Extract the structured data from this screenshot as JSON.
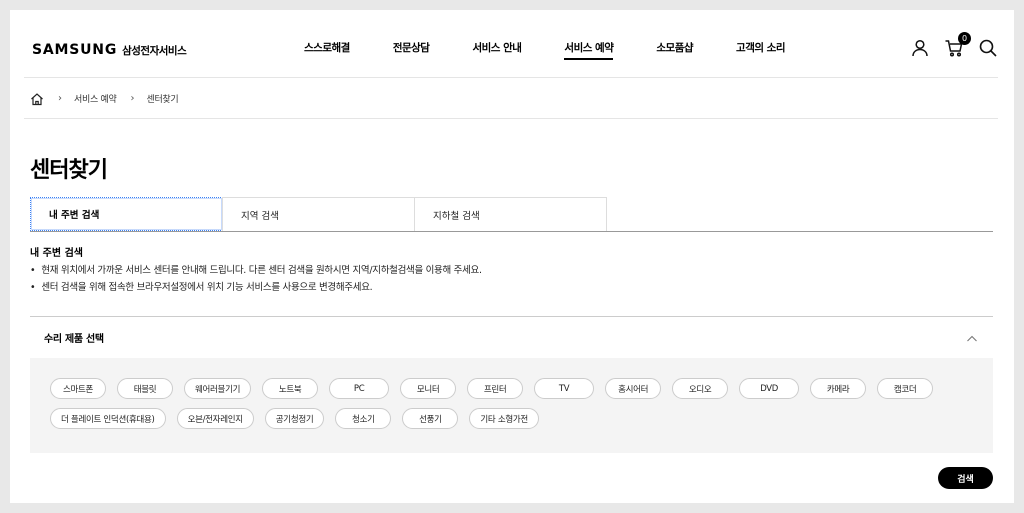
{
  "header": {
    "brand": "SAMSUNG",
    "brand_sub": "삼성전자서비스",
    "nav": [
      {
        "label": "스스로해결"
      },
      {
        "label": "전문상담"
      },
      {
        "label": "서비스 안내"
      },
      {
        "label": "서비스 예약",
        "active": true
      },
      {
        "label": "소모품샵"
      },
      {
        "label": "고객의 소리"
      }
    ],
    "cart_count": "0"
  },
  "breadcrumb": {
    "items": [
      "서비스 예약",
      "센터찾기"
    ]
  },
  "page": {
    "title": "센터찾기"
  },
  "tabs": [
    {
      "label": "내 주변 검색",
      "active": true
    },
    {
      "label": "지역 검색"
    },
    {
      "label": "지하철 검색"
    }
  ],
  "info": {
    "title": "내 주변 검색",
    "lines": [
      "현재 위치에서 가까운 서비스 센터를 안내해 드립니다. 다른 센터 검색을 원하시면 지역/지하철검색을 이용해 주세요.",
      "센터 검색을 위해 접속한 브라우저설정에서 위치 기능 서비스를 사용으로 변경해주세요."
    ]
  },
  "product": {
    "title": "수리 제품 선택",
    "chips": [
      "스마트폰",
      "태블릿",
      "웨어러블기기",
      "노트북",
      "PC",
      "모니터",
      "프린터",
      "TV",
      "홈시어터",
      "오디오",
      "DVD",
      "카메라",
      "캠코더",
      "더 플레이트 인덕션(휴대용)",
      "오븐/전자레인지",
      "공기청정기",
      "청소기",
      "선풍기",
      "기타 소형가전"
    ]
  },
  "search_label": "검색"
}
